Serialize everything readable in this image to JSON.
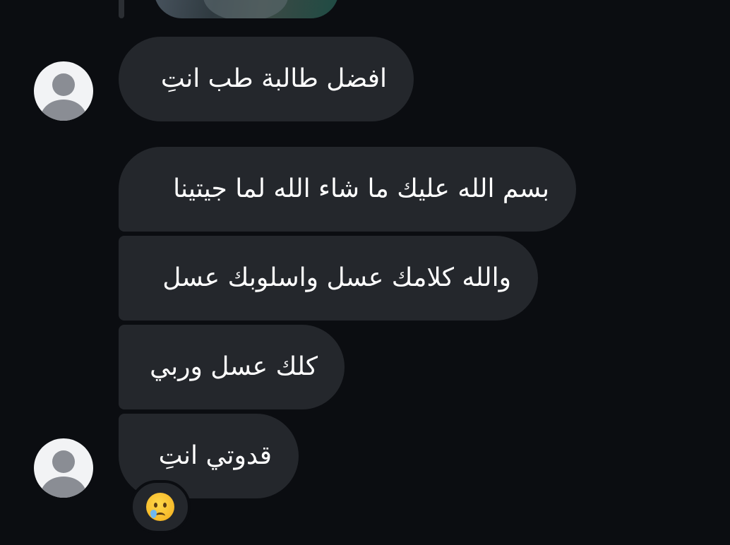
{
  "thread": {
    "messages": [
      {
        "text": "افضل طالبة طب انتِ"
      },
      {
        "text": "بسم الله عليك ما شاء الله لما جيتينا"
      },
      {
        "text": "والله كلامك عسل واسلوبك عسل"
      },
      {
        "text": "كلك عسل وربي"
      },
      {
        "text": "قدوتي انتِ"
      }
    ],
    "reaction": {
      "emoji_name": "crying-face",
      "emoji_char": "😢"
    }
  },
  "colors": {
    "background": "#0b0d11",
    "bubble": "#24272c",
    "text": "#ffffff",
    "avatar_bg": "#f2f3f5",
    "avatar_fg": "#8a8d94"
  }
}
